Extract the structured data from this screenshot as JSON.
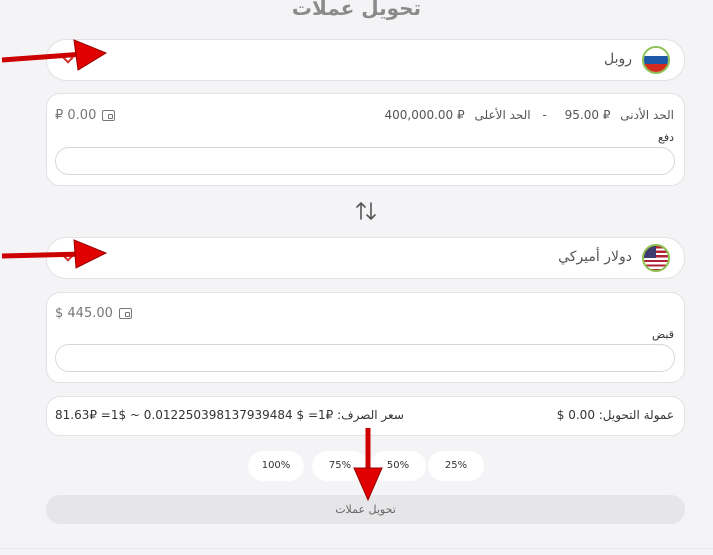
{
  "title": "تحويل عملات",
  "from_currency": {
    "name": "روبل",
    "flag": "russia-flag"
  },
  "pay_card": {
    "balance": "₽ 0.00",
    "min_label": "الحد الأدنى",
    "min_value": "₽ 95.00",
    "separator": "-",
    "max_label": "الحد الأعلى",
    "max_value": "₽ 400,000.00",
    "field_label": "دفع",
    "amount_value": ""
  },
  "to_currency": {
    "name": "دولار أميركي",
    "flag": "usa-flag"
  },
  "receive_card": {
    "balance": "$ 445.00",
    "field_label": "قبض",
    "amount_value": ""
  },
  "rate_card": {
    "fee": "عمولة التحويل: 0.00 $",
    "rate": "81.63₽ =1$ ~ 0.01225039813793948​4 $ =1₽ :سعر الصرف"
  },
  "percent_buttons": [
    "100%",
    "75%",
    "50%",
    "25%"
  ],
  "submit_label": "تحويل عملات",
  "colors": {
    "accent_arrow": "#e00000",
    "flag_ring": "#8cc152"
  },
  "icons": [
    "wallet-icon",
    "swap-arrows-icon",
    "chevron-down-icon"
  ]
}
